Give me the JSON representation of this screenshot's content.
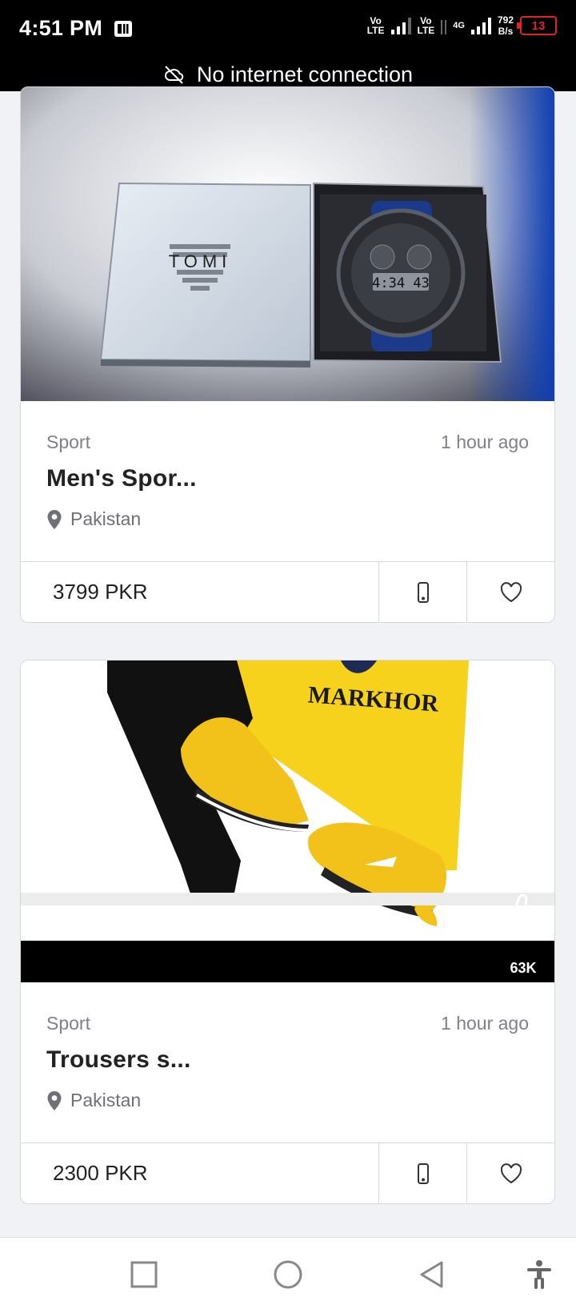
{
  "status_bar": {
    "time": "4:51 PM",
    "sim1_top": "Vo",
    "sim1_bottom": "LTE",
    "sim2_top": "Vo",
    "sim2_bottom": "LTE",
    "network": "4G",
    "speed_value": "792",
    "speed_unit": "B/s",
    "battery": "13"
  },
  "banner": {
    "text": "No internet connection",
    "icon": "cloud-off-icon"
  },
  "listings": [
    {
      "category": "Sport",
      "time": "1 hour ago",
      "title": "Men's Spor...",
      "location": "Pakistan",
      "price": "3799 PKR",
      "image_brand_text": "TOMI",
      "image_clock_text": "4:34 43"
    },
    {
      "category": "Sport",
      "time": "1 hour ago",
      "title": "Trousers s...",
      "location": "Pakistan",
      "price": "2300 PKR",
      "image_brand_text": "MARKHOR",
      "image_likes": "63K"
    }
  ],
  "nav": {
    "icons": [
      "square-recents-icon",
      "circle-home-icon",
      "triangle-back-icon",
      "accessibility-icon"
    ]
  },
  "colors": {
    "background": "#f1f2f6",
    "card_border": "#d7d8dd",
    "battery_low": "#e02424",
    "shirt_yellow": "#f6d21c"
  }
}
